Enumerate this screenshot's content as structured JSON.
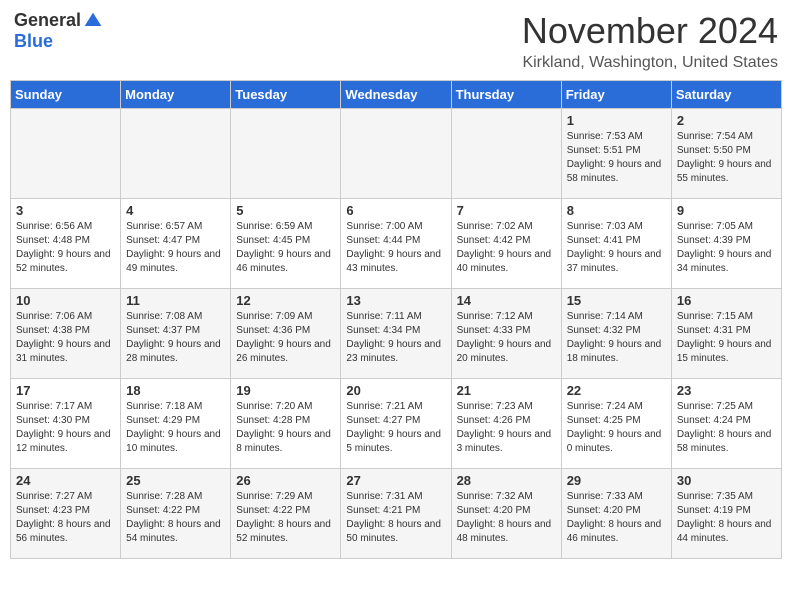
{
  "header": {
    "logo_general": "General",
    "logo_blue": "Blue",
    "month": "November 2024",
    "location": "Kirkland, Washington, United States"
  },
  "days_of_week": [
    "Sunday",
    "Monday",
    "Tuesday",
    "Wednesday",
    "Thursday",
    "Friday",
    "Saturday"
  ],
  "weeks": [
    [
      {
        "day": "",
        "info": ""
      },
      {
        "day": "",
        "info": ""
      },
      {
        "day": "",
        "info": ""
      },
      {
        "day": "",
        "info": ""
      },
      {
        "day": "",
        "info": ""
      },
      {
        "day": "1",
        "info": "Sunrise: 7:53 AM\nSunset: 5:51 PM\nDaylight: 9 hours and 58 minutes."
      },
      {
        "day": "2",
        "info": "Sunrise: 7:54 AM\nSunset: 5:50 PM\nDaylight: 9 hours and 55 minutes."
      }
    ],
    [
      {
        "day": "3",
        "info": "Sunrise: 6:56 AM\nSunset: 4:48 PM\nDaylight: 9 hours and 52 minutes."
      },
      {
        "day": "4",
        "info": "Sunrise: 6:57 AM\nSunset: 4:47 PM\nDaylight: 9 hours and 49 minutes."
      },
      {
        "day": "5",
        "info": "Sunrise: 6:59 AM\nSunset: 4:45 PM\nDaylight: 9 hours and 46 minutes."
      },
      {
        "day": "6",
        "info": "Sunrise: 7:00 AM\nSunset: 4:44 PM\nDaylight: 9 hours and 43 minutes."
      },
      {
        "day": "7",
        "info": "Sunrise: 7:02 AM\nSunset: 4:42 PM\nDaylight: 9 hours and 40 minutes."
      },
      {
        "day": "8",
        "info": "Sunrise: 7:03 AM\nSunset: 4:41 PM\nDaylight: 9 hours and 37 minutes."
      },
      {
        "day": "9",
        "info": "Sunrise: 7:05 AM\nSunset: 4:39 PM\nDaylight: 9 hours and 34 minutes."
      }
    ],
    [
      {
        "day": "10",
        "info": "Sunrise: 7:06 AM\nSunset: 4:38 PM\nDaylight: 9 hours and 31 minutes."
      },
      {
        "day": "11",
        "info": "Sunrise: 7:08 AM\nSunset: 4:37 PM\nDaylight: 9 hours and 28 minutes."
      },
      {
        "day": "12",
        "info": "Sunrise: 7:09 AM\nSunset: 4:36 PM\nDaylight: 9 hours and 26 minutes."
      },
      {
        "day": "13",
        "info": "Sunrise: 7:11 AM\nSunset: 4:34 PM\nDaylight: 9 hours and 23 minutes."
      },
      {
        "day": "14",
        "info": "Sunrise: 7:12 AM\nSunset: 4:33 PM\nDaylight: 9 hours and 20 minutes."
      },
      {
        "day": "15",
        "info": "Sunrise: 7:14 AM\nSunset: 4:32 PM\nDaylight: 9 hours and 18 minutes."
      },
      {
        "day": "16",
        "info": "Sunrise: 7:15 AM\nSunset: 4:31 PM\nDaylight: 9 hours and 15 minutes."
      }
    ],
    [
      {
        "day": "17",
        "info": "Sunrise: 7:17 AM\nSunset: 4:30 PM\nDaylight: 9 hours and 12 minutes."
      },
      {
        "day": "18",
        "info": "Sunrise: 7:18 AM\nSunset: 4:29 PM\nDaylight: 9 hours and 10 minutes."
      },
      {
        "day": "19",
        "info": "Sunrise: 7:20 AM\nSunset: 4:28 PM\nDaylight: 9 hours and 8 minutes."
      },
      {
        "day": "20",
        "info": "Sunrise: 7:21 AM\nSunset: 4:27 PM\nDaylight: 9 hours and 5 minutes."
      },
      {
        "day": "21",
        "info": "Sunrise: 7:23 AM\nSunset: 4:26 PM\nDaylight: 9 hours and 3 minutes."
      },
      {
        "day": "22",
        "info": "Sunrise: 7:24 AM\nSunset: 4:25 PM\nDaylight: 9 hours and 0 minutes."
      },
      {
        "day": "23",
        "info": "Sunrise: 7:25 AM\nSunset: 4:24 PM\nDaylight: 8 hours and 58 minutes."
      }
    ],
    [
      {
        "day": "24",
        "info": "Sunrise: 7:27 AM\nSunset: 4:23 PM\nDaylight: 8 hours and 56 minutes."
      },
      {
        "day": "25",
        "info": "Sunrise: 7:28 AM\nSunset: 4:22 PM\nDaylight: 8 hours and 54 minutes."
      },
      {
        "day": "26",
        "info": "Sunrise: 7:29 AM\nSunset: 4:22 PM\nDaylight: 8 hours and 52 minutes."
      },
      {
        "day": "27",
        "info": "Sunrise: 7:31 AM\nSunset: 4:21 PM\nDaylight: 8 hours and 50 minutes."
      },
      {
        "day": "28",
        "info": "Sunrise: 7:32 AM\nSunset: 4:20 PM\nDaylight: 8 hours and 48 minutes."
      },
      {
        "day": "29",
        "info": "Sunrise: 7:33 AM\nSunset: 4:20 PM\nDaylight: 8 hours and 46 minutes."
      },
      {
        "day": "30",
        "info": "Sunrise: 7:35 AM\nSunset: 4:19 PM\nDaylight: 8 hours and 44 minutes."
      }
    ]
  ]
}
